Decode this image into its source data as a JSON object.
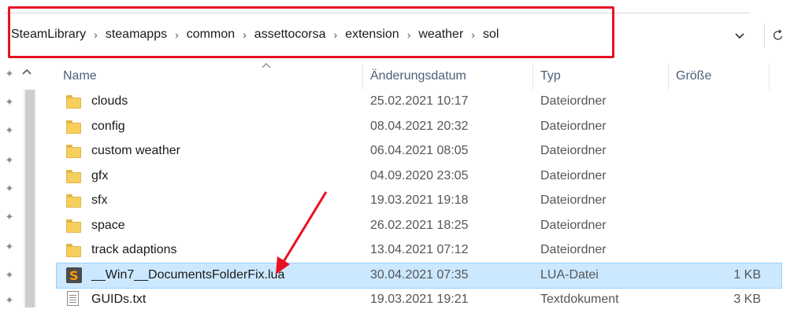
{
  "breadcrumb": [
    "SteamLibrary",
    "steamapps",
    "common",
    "assettocorsa",
    "extension",
    "weather",
    "sol"
  ],
  "breadcrumb_separator": "›",
  "columns": {
    "name": "Name",
    "date": "Änderungsdatum",
    "type": "Typ",
    "size": "Größe"
  },
  "files": [
    {
      "name": "clouds",
      "date": "25.02.2021 10:17",
      "type": "Dateiordner",
      "size": "",
      "icon": "folder-icon"
    },
    {
      "name": "config",
      "date": "08.04.2021 20:32",
      "type": "Dateiordner",
      "size": "",
      "icon": "folder-icon"
    },
    {
      "name": "custom weather",
      "date": "06.04.2021 08:05",
      "type": "Dateiordner",
      "size": "",
      "icon": "folder-icon"
    },
    {
      "name": "gfx",
      "date": "04.09.2020 23:05",
      "type": "Dateiordner",
      "size": "",
      "icon": "folder-icon"
    },
    {
      "name": "sfx",
      "date": "19.03.2021 19:18",
      "type": "Dateiordner",
      "size": "",
      "icon": "folder-icon"
    },
    {
      "name": "space",
      "date": "26.02.2021 18:25",
      "type": "Dateiordner",
      "size": "",
      "icon": "folder-icon"
    },
    {
      "name": "track adaptions",
      "date": "13.04.2021 07:12",
      "type": "Dateiordner",
      "size": "",
      "icon": "folder-icon"
    },
    {
      "name": "__Win7__DocumentsFolderFix.lua",
      "date": "30.04.2021 07:35",
      "type": "LUA-Datei",
      "size": "1 KB",
      "icon": "lua-file-icon",
      "selected": true
    },
    {
      "name": "GUIDs.txt",
      "date": "19.03.2021 19:21",
      "type": "Textdokument",
      "size": "3 KB",
      "icon": "text-file-icon"
    }
  ],
  "colors": {
    "highlight_box": "#e81123",
    "selection": "#cce8ff",
    "annotation_arrow": "#e81123"
  }
}
